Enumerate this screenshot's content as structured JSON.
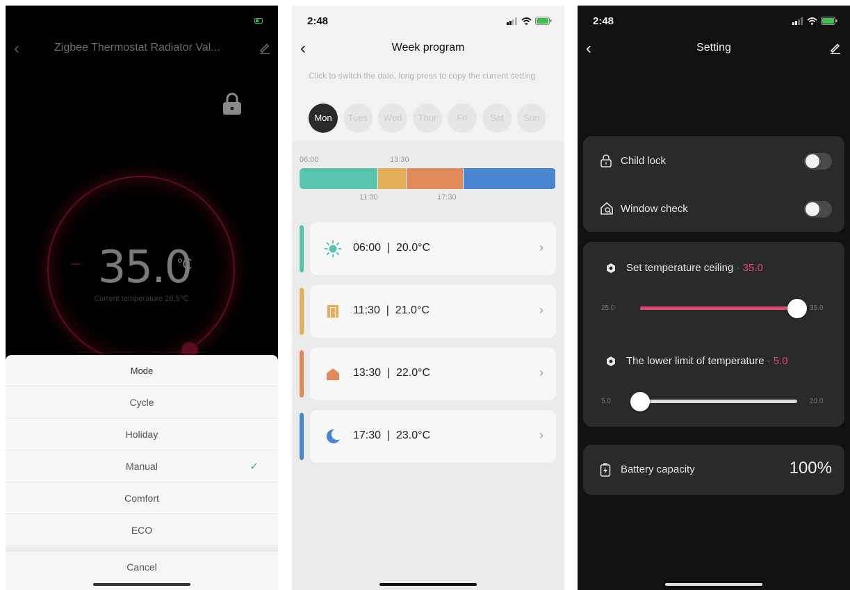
{
  "phone1": {
    "title": "Zigbee Thermostat Radiator Val...",
    "temperature": "35.0",
    "unit": "℃",
    "current_temperature": "Current temperature 26.5℃",
    "mode_sheet": {
      "header": "Mode",
      "options": [
        "Cycle",
        "Holiday",
        "Manual",
        "Comfort",
        "ECO"
      ],
      "selected": "Manual",
      "check": "✓",
      "cancel": "Cancel"
    }
  },
  "phone2": {
    "status_time": "2:48",
    "title": "Week program",
    "hint": "Click to switch the date, long press to copy the current setting",
    "days": [
      "Mon",
      "Tues",
      "Wed",
      "Thur",
      "Fri",
      "Sat",
      "Sun"
    ],
    "active_day": "Mon",
    "timeline": {
      "top_labels": [
        "06:00",
        "13:30"
      ],
      "bottom_labels": [
        "11:30",
        "17:30"
      ],
      "segments": [
        {
          "start": "06:00",
          "end": "11:30",
          "color": "#58c4b0"
        },
        {
          "start": "11:30",
          "end": "13:30",
          "color": "#e2ae58"
        },
        {
          "start": "13:30",
          "end": "17:30",
          "color": "#e18a5a"
        },
        {
          "start": "17:30",
          "end": "24:00",
          "color": "#4a86cf"
        }
      ]
    },
    "slots": [
      {
        "time": "06:00",
        "temp": "20.0°C",
        "icon": "sun-icon",
        "color": "#58c4b0"
      },
      {
        "time": "11:30",
        "temp": "21.0°C",
        "icon": "door-exit-icon",
        "color": "#e2ae58"
      },
      {
        "time": "13:30",
        "temp": "22.0°C",
        "icon": "home-icon",
        "color": "#e18a5a"
      },
      {
        "time": "17:30",
        "temp": "23.0°C",
        "icon": "moon-icon",
        "color": "#4a86cf"
      }
    ],
    "slot_separator": "|",
    "chevron": "›"
  },
  "phone3": {
    "status_time": "2:48",
    "title": "Setting",
    "child_lock": {
      "label": "Child lock",
      "on": false
    },
    "window_check": {
      "label": "Window check",
      "on": false
    },
    "ceiling": {
      "label": "Set temperature ceiling",
      "value": "35.0",
      "min": "25.0",
      "max": "35.0",
      "level": 1.0
    },
    "lower_limit": {
      "label": "The lower limit of temperature",
      "value": "5.0",
      "min": "5.0",
      "max": "20.0",
      "level": 0.0
    },
    "separator": "·",
    "battery": {
      "label": "Battery capacity",
      "value": "100%"
    }
  }
}
